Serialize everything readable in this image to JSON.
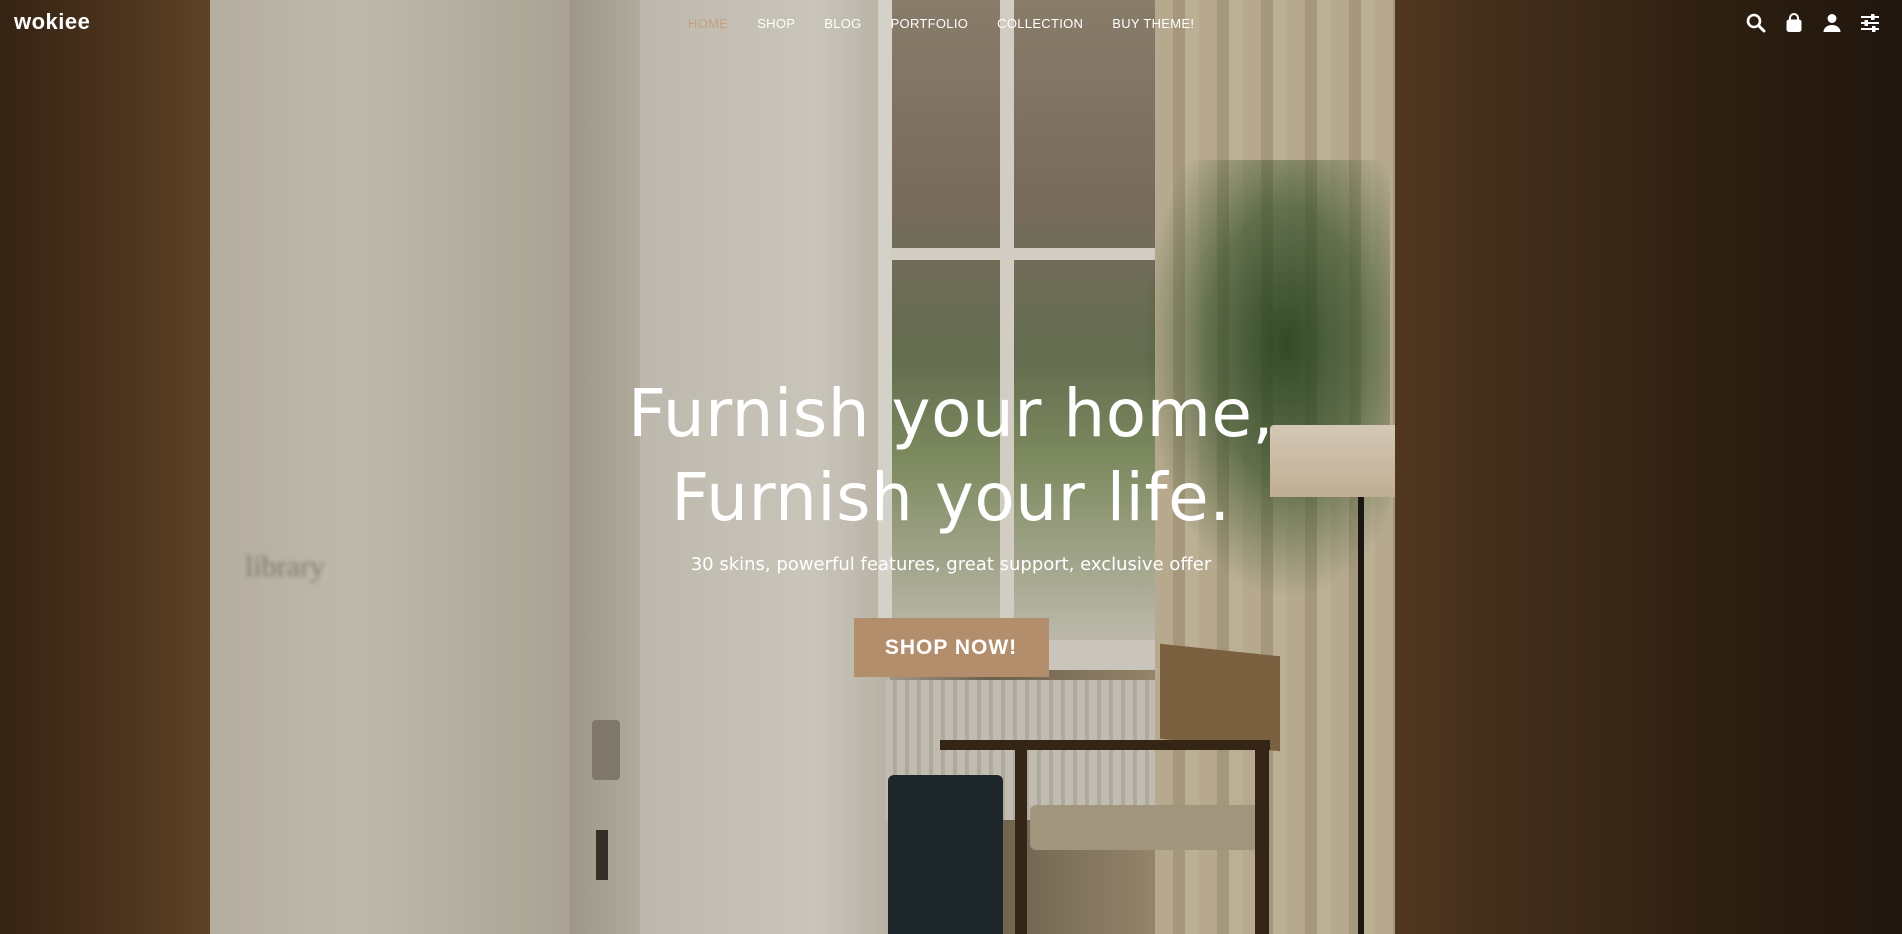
{
  "brand": {
    "logo_text": "wokiee"
  },
  "nav": {
    "items": [
      {
        "label": "HOME",
        "active": true
      },
      {
        "label": "SHOP",
        "active": false
      },
      {
        "label": "BLOG",
        "active": false
      },
      {
        "label": "PORTFOLIO",
        "active": false
      },
      {
        "label": "COLLECTION",
        "active": false
      },
      {
        "label": "BUY THEME!",
        "active": false
      }
    ]
  },
  "header_icons": [
    "search-icon",
    "shopping-bag-icon",
    "user-icon",
    "settings-sliders-icon"
  ],
  "hero": {
    "headline_line1": "Furnish your home,",
    "headline_line2": "Furnish your life.",
    "subtitle": "30 skins, powerful features, great support, exclusive offer",
    "cta_label": "SHOP NOW!"
  },
  "background_sign": "library",
  "colors": {
    "accent": "#b38e6d",
    "active_nav": "#c6a07c",
    "text": "#ffffff"
  }
}
